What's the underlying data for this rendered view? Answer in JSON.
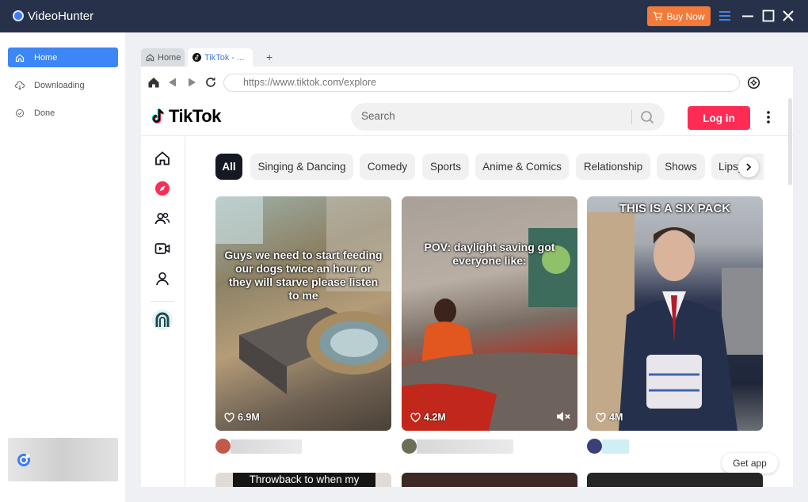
{
  "app": {
    "title": "VideoHunter",
    "buy_label": "Buy Now",
    "accent": "#3d86f5",
    "buy_color": "#f47a3a"
  },
  "sidebar": {
    "items": [
      {
        "label": "Home",
        "icon": "home-icon",
        "active": true
      },
      {
        "label": "Downloading",
        "icon": "cloud-download-icon",
        "active": false
      },
      {
        "label": "Done",
        "icon": "check-circle-icon",
        "active": false
      }
    ]
  },
  "browser": {
    "tabs": [
      {
        "label": "Home",
        "icon": "home-icon"
      },
      {
        "label": "TikTok - ...",
        "icon": "tiktok-icon"
      }
    ],
    "add_tab": "+",
    "url": "https://www.tiktok.com/explore"
  },
  "tiktok": {
    "logo_text": "TikTok",
    "search_placeholder": "Search",
    "login_label": "Log in",
    "brand_color": "#fe2c55",
    "categories": [
      "All",
      "Singing & Dancing",
      "Comedy",
      "Sports",
      "Anime & Comics",
      "Relationship",
      "Shows",
      "Lipsync"
    ],
    "videos": [
      {
        "caption": "Guys we need to start feeding our dogs twice an hour or they will starve please listen to me",
        "likes": "6.9M"
      },
      {
        "caption": "POV: daylight saving got everyone like:",
        "likes": "4.2M",
        "muted": true
      },
      {
        "caption": "THIS IS A SIX PACK",
        "likes": "4M"
      }
    ],
    "bottom_caption": "Throwback to when my",
    "get_app": "Get app"
  }
}
